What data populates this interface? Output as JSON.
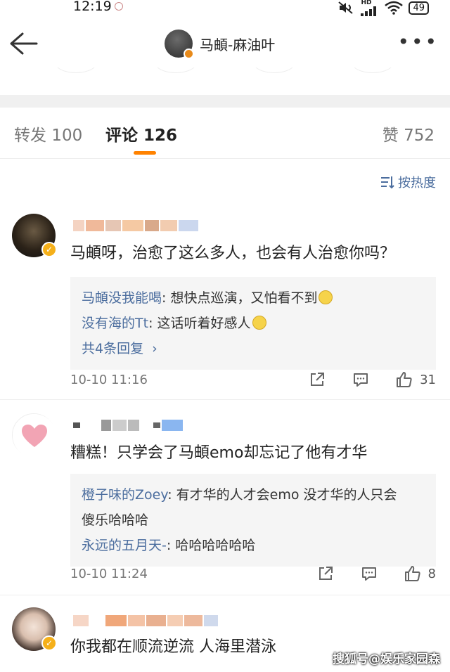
{
  "status_bar": {
    "time": "12:19",
    "network": "HD",
    "battery": "49"
  },
  "header": {
    "account_name": "马頔-麻油叶"
  },
  "tabs": [
    {
      "label": "转发",
      "count": "100"
    },
    {
      "label": "评论",
      "count": "126"
    },
    {
      "label": "赞",
      "count": "752"
    }
  ],
  "sort": {
    "label": "按热度"
  },
  "comments": [
    {
      "text": "马頔呀，治愈了这么多人，也会有人治愈你吗？",
      "replies": [
        {
          "user": "马頔没我能喝",
          "text": "想快点巡演，又怕看不到"
        },
        {
          "user": "没有海的Tt",
          "text": "这话听着好感人"
        }
      ],
      "more_replies": "共4条回复",
      "time": "10-10 11:16",
      "likes": "31"
    },
    {
      "text": "糟糕！只学会了马頔emo却忘记了他有才华",
      "replies": [
        {
          "user": "橙子味的Zoey",
          "text": "有才华的人才会emo 没才华的人只会",
          "text2": "傻乐哈哈哈"
        },
        {
          "user": "永远的五月天-",
          "text": "哈哈哈哈哈哈"
        }
      ],
      "time": "10-10 11:24",
      "likes": "8"
    },
    {
      "text": "你我都在顺流逆流 人海里潜泳"
    }
  ],
  "watermark": "搜狐号@娱乐家园森",
  "colors": {
    "accent": "#ff8200",
    "link": "#4b6d9e",
    "verified": "#f5b01a"
  }
}
